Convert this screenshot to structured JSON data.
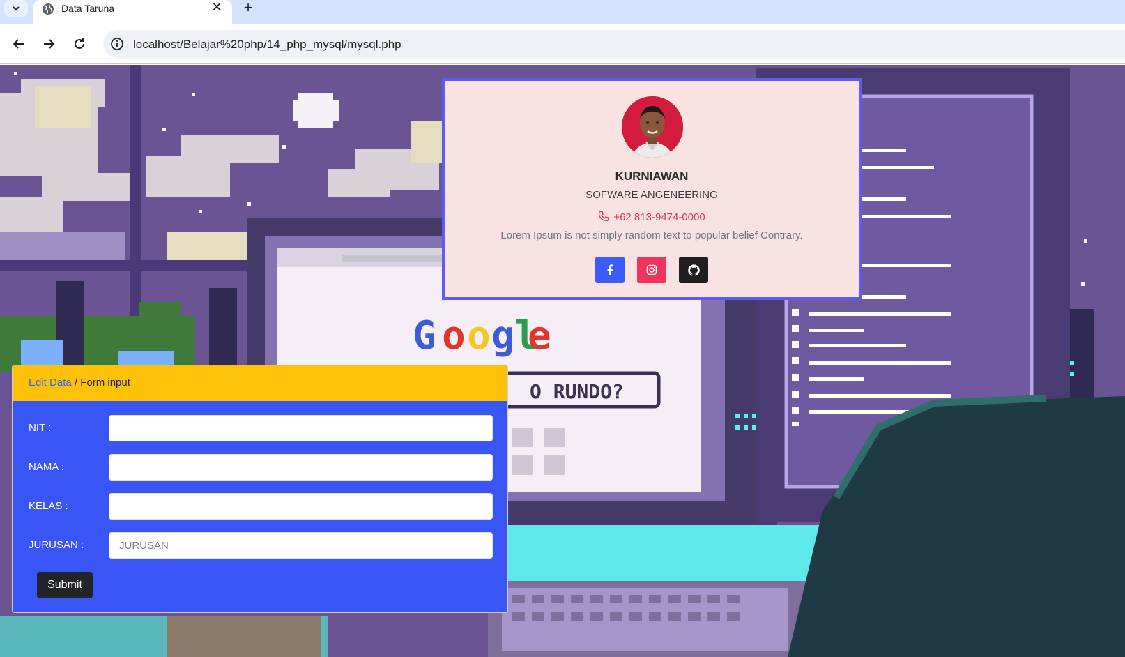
{
  "browser": {
    "tab_title": "Data Taruna",
    "url": "localhost/Belajar%20php/14_php_mysql/mysql.php"
  },
  "profile": {
    "name": "KURNIAWAN",
    "role": "SOFWARE ANGENEERING",
    "phone": "+62 813-9474-0000",
    "description": "Lorem Ipsum is not simply random text to popular belief Contrary.",
    "socials": [
      "facebook-icon",
      "instagram-icon",
      "github-icon"
    ]
  },
  "form": {
    "breadcrumb_link": "Edit Data",
    "breadcrumb_separator": " / ",
    "breadcrumb_current": "Form input",
    "fields": [
      {
        "label": "NIT :",
        "value": "",
        "placeholder": ""
      },
      {
        "label": "NAMA :",
        "value": "",
        "placeholder": ""
      },
      {
        "label": "KELAS :",
        "value": "",
        "placeholder": ""
      },
      {
        "label": "JURUSAN :",
        "value": "",
        "placeholder": "JURUSAN"
      }
    ],
    "submit_label": "Submit"
  },
  "background": {
    "search_logo": "Google",
    "search_box_text": "A O RUNDO?"
  },
  "colors": {
    "card_border": "#5d5bf2",
    "card_bg": "#f9e2e2",
    "form_header": "#ffc107",
    "form_body": "#3955f6",
    "phone": "#e0354d"
  }
}
